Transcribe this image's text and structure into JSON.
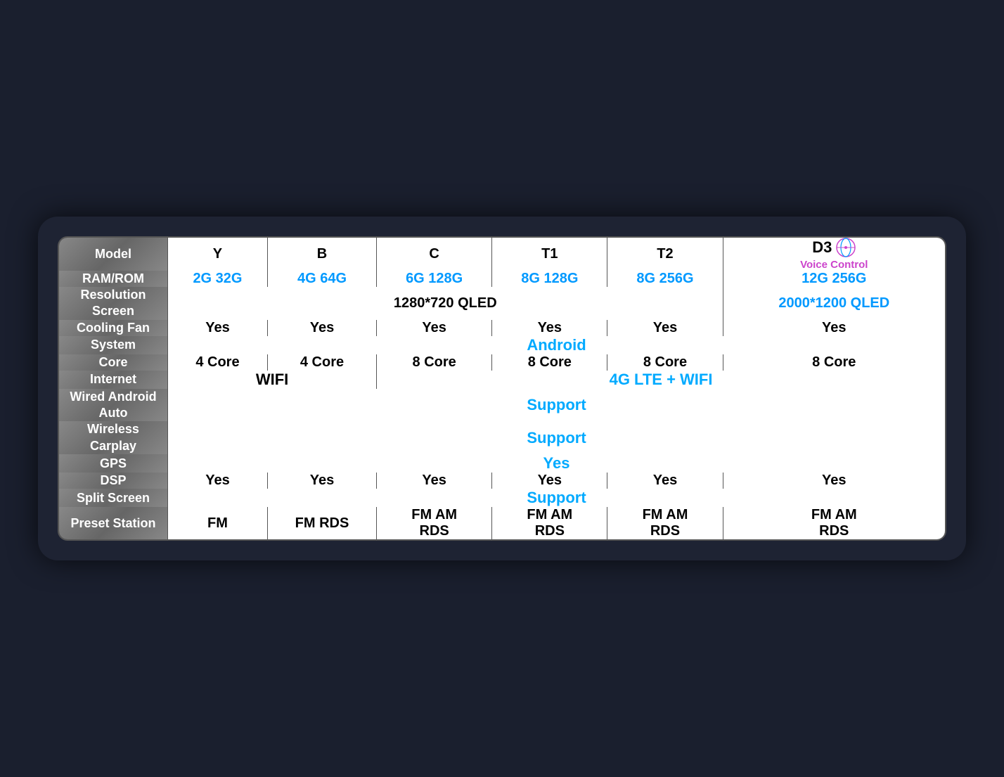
{
  "table": {
    "rows": [
      {
        "id": "model",
        "label": "Model",
        "cells": [
          {
            "text": "Y",
            "type": "normal"
          },
          {
            "text": "B",
            "type": "normal"
          },
          {
            "text": "C",
            "type": "normal"
          },
          {
            "text": "T1",
            "type": "normal"
          },
          {
            "text": "T2",
            "type": "normal"
          },
          {
            "text": "D3",
            "type": "d3"
          }
        ]
      },
      {
        "id": "ram",
        "label": "RAM/ROM",
        "cells": [
          {
            "text": "2G 32G",
            "type": "blue"
          },
          {
            "text": "4G 64G",
            "type": "blue"
          },
          {
            "text": "6G 128G",
            "type": "blue"
          },
          {
            "text": "8G 128G",
            "type": "blue"
          },
          {
            "text": "8G 256G",
            "type": "blue"
          },
          {
            "text": "12G 256G",
            "type": "blue"
          }
        ]
      },
      {
        "id": "resolution",
        "label": "Resolution\nScreen",
        "cells": [
          {
            "text": "1280*720 QLED",
            "type": "span5"
          },
          {
            "text": "2000*1200 QLED",
            "type": "blue-last"
          }
        ]
      },
      {
        "id": "cooling",
        "label": "Cooling Fan",
        "cells": [
          {
            "text": "Yes",
            "type": "normal"
          },
          {
            "text": "Yes",
            "type": "normal"
          },
          {
            "text": "Yes",
            "type": "normal"
          },
          {
            "text": "Yes",
            "type": "normal"
          },
          {
            "text": "Yes",
            "type": "normal"
          },
          {
            "text": "Yes",
            "type": "normal"
          }
        ]
      },
      {
        "id": "system",
        "label": "System",
        "cells": [
          {
            "text": "Android",
            "type": "span-all-blue"
          }
        ]
      },
      {
        "id": "core",
        "label": "Core",
        "cells": [
          {
            "text": "4 Core",
            "type": "normal"
          },
          {
            "text": "4 Core",
            "type": "normal"
          },
          {
            "text": "8 Core",
            "type": "normal"
          },
          {
            "text": "8 Core",
            "type": "normal"
          },
          {
            "text": "8 Core",
            "type": "normal"
          },
          {
            "text": "8 Core",
            "type": "normal"
          }
        ]
      },
      {
        "id": "internet",
        "label": "Internet",
        "cells": [
          {
            "text": "WIFI",
            "type": "span2-normal"
          },
          {
            "text": "4G LTE + WIFI",
            "type": "span4-blue"
          }
        ]
      },
      {
        "id": "wired",
        "label": "Wired Android\nAuto",
        "cells": [
          {
            "text": "Support",
            "type": "span-all-blue"
          }
        ]
      },
      {
        "id": "wireless",
        "label": "Wireless\nCarplay",
        "cells": [
          {
            "text": "Support",
            "type": "span-all-blue"
          }
        ]
      },
      {
        "id": "gps",
        "label": "GPS",
        "cells": [
          {
            "text": "Yes",
            "type": "span-all-blue"
          }
        ]
      },
      {
        "id": "dsp",
        "label": "DSP",
        "cells": [
          {
            "text": "Yes",
            "type": "normal"
          },
          {
            "text": "Yes",
            "type": "normal"
          },
          {
            "text": "Yes",
            "type": "normal"
          },
          {
            "text": "Yes",
            "type": "normal"
          },
          {
            "text": "Yes",
            "type": "normal"
          },
          {
            "text": "Yes",
            "type": "normal"
          }
        ]
      },
      {
        "id": "split",
        "label": "Split Screen",
        "cells": [
          {
            "text": "Support",
            "type": "span-all-blue"
          }
        ]
      },
      {
        "id": "preset",
        "label": "Preset Station",
        "cells": [
          {
            "text": "FM",
            "type": "normal"
          },
          {
            "text": "FM RDS",
            "type": "normal"
          },
          {
            "text": "FM AM\nRDS",
            "type": "normal"
          },
          {
            "text": "FM AM\nRDS",
            "type": "normal"
          },
          {
            "text": "FM AM\nRDS",
            "type": "normal"
          },
          {
            "text": "FM AM\nRDS",
            "type": "normal"
          }
        ]
      }
    ]
  },
  "d3_subtitle": "Voice Control"
}
